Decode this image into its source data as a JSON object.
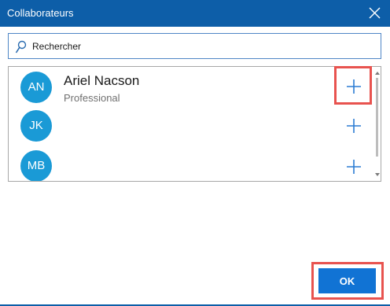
{
  "window": {
    "title": "Collaborateurs",
    "close_icon": "close-icon"
  },
  "search": {
    "placeholder": "Rechercher",
    "icon": "search-icon"
  },
  "collaborators": [
    {
      "initials": "AN",
      "name": "Ariel Nacson",
      "role": "Professional",
      "add_icon": "plus-icon"
    },
    {
      "initials": "JK",
      "name": "",
      "role": "",
      "add_icon": "plus-icon"
    },
    {
      "initials": "MB",
      "name": "",
      "role": "",
      "add_icon": "plus-icon"
    }
  ],
  "footer": {
    "ok_label": "OK"
  },
  "colors": {
    "title_bar": "#0d5ea8",
    "avatar": "#1a9ad6",
    "accent": "#1173d4",
    "highlight": "#e8534f"
  }
}
